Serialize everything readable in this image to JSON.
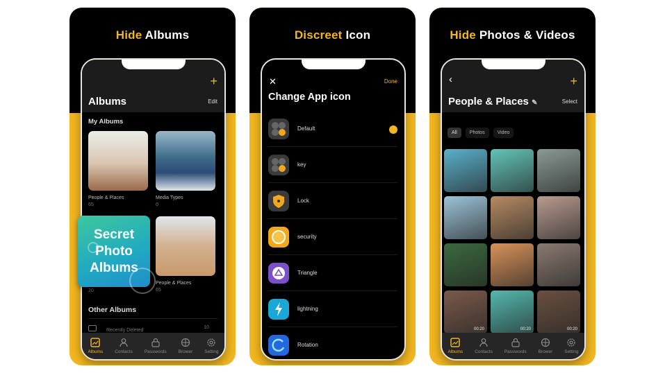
{
  "panels": [
    {
      "headline_highlight": "Hide",
      "headline_rest": " Albums",
      "screen": {
        "title": "Albums",
        "header_action": "Edit",
        "add_icon": "plus-icon",
        "section_my": "My Albums",
        "albums": [
          {
            "name": "People & Places",
            "count": "65"
          },
          {
            "name": "Media Types",
            "count": "0"
          },
          {
            "name": "People & Places",
            "count": "65"
          }
        ],
        "hidden_album_count": "20",
        "section_other": "Other Albums",
        "other_row": {
          "label": "Recently Deleted",
          "count": "10"
        },
        "badge_lines": [
          "Secret",
          "Photo",
          "Albums"
        ]
      }
    },
    {
      "headline_highlight": "Discreet",
      "headline_rest": " Icon",
      "screen": {
        "close_icon": "close-icon",
        "done_label": "Done",
        "title": "Change App icon",
        "icons": [
          {
            "label": "Default",
            "selected": true,
            "color": "#3a3a3a"
          },
          {
            "label": "key",
            "selected": false,
            "color": "#3a3a3a"
          },
          {
            "label": "Lock",
            "selected": false,
            "color": "#3a3a3a"
          },
          {
            "label": "security",
            "selected": false,
            "color": "#f2a81d"
          },
          {
            "label": "Triangle",
            "selected": false,
            "color": "#7b4fc8"
          },
          {
            "label": "lightning",
            "selected": false,
            "color": "#1ba7d6"
          },
          {
            "label": "Rotation",
            "selected": false,
            "color": "#2468e0"
          }
        ]
      }
    },
    {
      "headline_highlight": "Hide",
      "headline_rest": " Photos & Videos",
      "screen": {
        "back_icon": "back-chevron-icon",
        "title": "People & Places",
        "header_action": "Select",
        "filters": [
          {
            "label": "All",
            "active": true
          },
          {
            "label": "Photos",
            "active": false
          },
          {
            "label": "Video",
            "active": false
          }
        ],
        "media": [
          {
            "type": "photo",
            "color": "#5ab0c9"
          },
          {
            "type": "photo",
            "color": "#63c4b8"
          },
          {
            "type": "photo",
            "color": "#8a9a95"
          },
          {
            "type": "photo",
            "color": "#9cc4d8"
          },
          {
            "type": "photo",
            "color": "#b58a62"
          },
          {
            "type": "photo",
            "color": "#b89b8f"
          },
          {
            "type": "photo",
            "color": "#3a6a3e"
          },
          {
            "type": "photo",
            "color": "#d8925a"
          },
          {
            "type": "photo",
            "color": "#8a7a70"
          },
          {
            "type": "video",
            "color": "#7a5a4a",
            "duration": "00:20"
          },
          {
            "type": "video",
            "color": "#54b8ae",
            "duration": "00:20"
          },
          {
            "type": "video",
            "color": "#6a5040",
            "duration": "00:20"
          }
        ]
      }
    }
  ],
  "tabbar": [
    {
      "label": "Albums",
      "icon": "albums-icon",
      "active": true
    },
    {
      "label": "Contacts",
      "icon": "contacts-icon",
      "active": false
    },
    {
      "label": "Passwords",
      "icon": "passwords-icon",
      "active": false
    },
    {
      "label": "Brower",
      "icon": "browser-icon",
      "active": false
    },
    {
      "label": "Setting",
      "icon": "settings-icon",
      "active": false
    }
  ],
  "colors": {
    "accent": "#f2b620",
    "background": "#000000",
    "header": "#1c1c1c"
  }
}
